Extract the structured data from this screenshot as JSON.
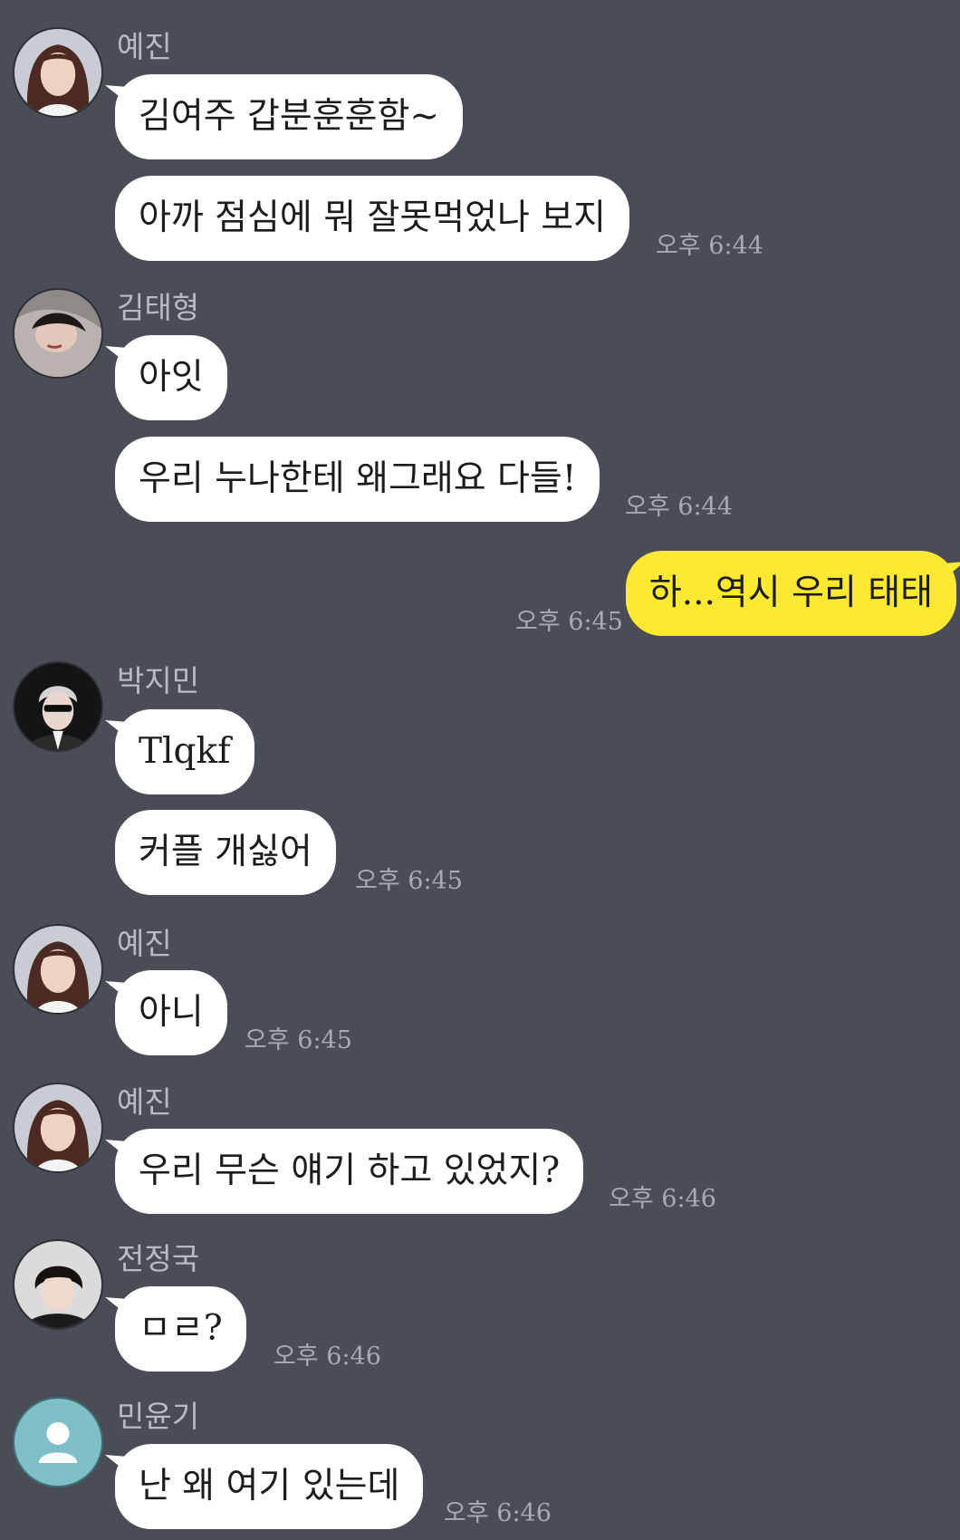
{
  "messages": [
    {
      "sender": "예진",
      "lines": [
        "김여주 갑분훈훈함~",
        "아까 점심에 뭐 잘못먹었나 보지"
      ],
      "time": "오후 6:44"
    },
    {
      "sender": "김태형",
      "lines": [
        "아잇",
        "우리 누나한테 왜그래요 다들!"
      ],
      "time": "오후 6:44"
    },
    {
      "sender": "",
      "lines": [
        "하...역시 우리 태태"
      ],
      "time": "오후 6:45"
    },
    {
      "sender": "박지민",
      "lines": [
        "Tlqkf",
        "커플 개싫어"
      ],
      "time": "오후 6:45"
    },
    {
      "sender": "예진",
      "lines": [
        "아니"
      ],
      "time": "오후 6:45"
    },
    {
      "sender": "예진",
      "lines": [
        "우리 무슨 얘기 하고 있었지?"
      ],
      "time": "오후 6:46"
    },
    {
      "sender": "전정국",
      "lines": [
        "ㅁㄹ?"
      ],
      "time": "오후 6:46"
    },
    {
      "sender": "민윤기",
      "lines": [
        "난 왜 여기 있는데"
      ],
      "time": "오후 6:46"
    }
  ],
  "colors": {
    "background": "#4a4d55",
    "incoming_bubble": "#ffffff",
    "outgoing_bubble": "#fee932",
    "sender_name": "#b8bbc2",
    "timestamp": "#a7aab1",
    "default_avatar": "#7fbfc7"
  },
  "icons": {
    "default_avatar": "person-icon"
  }
}
